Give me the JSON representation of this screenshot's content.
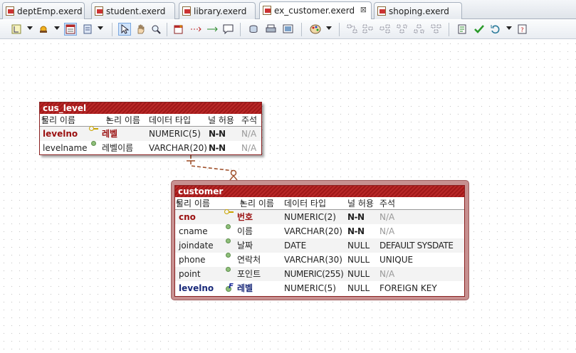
{
  "tabs": [
    {
      "label": "deptEmp.exerd",
      "active": false
    },
    {
      "label": "student.exerd",
      "active": false
    },
    {
      "label": "library.exerd",
      "active": false
    },
    {
      "label": "ex_customer.exerd",
      "active": true,
      "close": "⊠"
    },
    {
      "label": "shoping.exerd",
      "active": false
    }
  ],
  "headers": {
    "physical": "물리 이름",
    "logical": "논리 이름",
    "datatype": "데이터 타입",
    "nullable": "널 허용",
    "comment": "주석",
    "sort_mark": "*"
  },
  "entities": {
    "cus_level": {
      "title": "cus_level",
      "rows": [
        {
          "physical": "levelno",
          "logical": "레벨",
          "type": "NUMERIC(5)",
          "nullable": "N-N",
          "comment": "N/A",
          "key": "pk"
        },
        {
          "physical": "levelname",
          "logical": "레벨이름",
          "type": "VARCHAR(20)",
          "nullable": "N-N",
          "comment": "N/A",
          "key": "none"
        }
      ]
    },
    "customer": {
      "title": "customer",
      "rows": [
        {
          "physical": "cno",
          "logical": "번호",
          "type": "NUMERIC(2)",
          "nullable": "N-N",
          "comment": "N/A",
          "key": "pk"
        },
        {
          "physical": "cname",
          "logical": "이름",
          "type": "VARCHAR(20)",
          "nullable": "N-N",
          "comment": "N/A",
          "key": "none"
        },
        {
          "physical": "joindate",
          "logical": "날짜",
          "type": "DATE",
          "nullable": "NULL",
          "comment": "DEFAULT SYSDATE",
          "key": "none"
        },
        {
          "physical": "phone",
          "logical": "연락처",
          "type": "VARCHAR(30)",
          "nullable": "NULL",
          "comment": "UNIQUE",
          "key": "none"
        },
        {
          "physical": "point",
          "logical": "포인트",
          "type": "NUMERIC(255)",
          "nullable": "NULL",
          "comment": "N/A",
          "key": "none"
        },
        {
          "physical": "levelno",
          "logical": "레벨",
          "type": "NUMERIC(5)",
          "nullable": "NULL",
          "comment": "FOREIGN KEY",
          "key": "fk"
        }
      ]
    }
  },
  "colors": {
    "entity_title": "#a01818",
    "pk_text": "#9a1010",
    "fk_text": "#1a2a7a",
    "relationship": "#a0522d"
  },
  "toolbar": [
    "layout-icon",
    "dropdown",
    "sun-icon",
    "dropdown",
    "table-icon",
    "note-icon",
    "dropdown",
    "select-arrow-icon",
    "hand-icon",
    "zoom-icon",
    "entity-icon",
    "relation-nonidentifying-icon",
    "relation-identifying-icon",
    "comment-icon",
    "db-icon",
    "print-icon",
    "image-icon",
    "palette-icon",
    "dropdown",
    "align-1-icon",
    "align-2-icon",
    "align-3-icon",
    "align-4-icon",
    "align-5-icon",
    "align-6-icon",
    "doc-icon",
    "validate-icon",
    "refresh-icon",
    "dropdown",
    "help-icon"
  ]
}
